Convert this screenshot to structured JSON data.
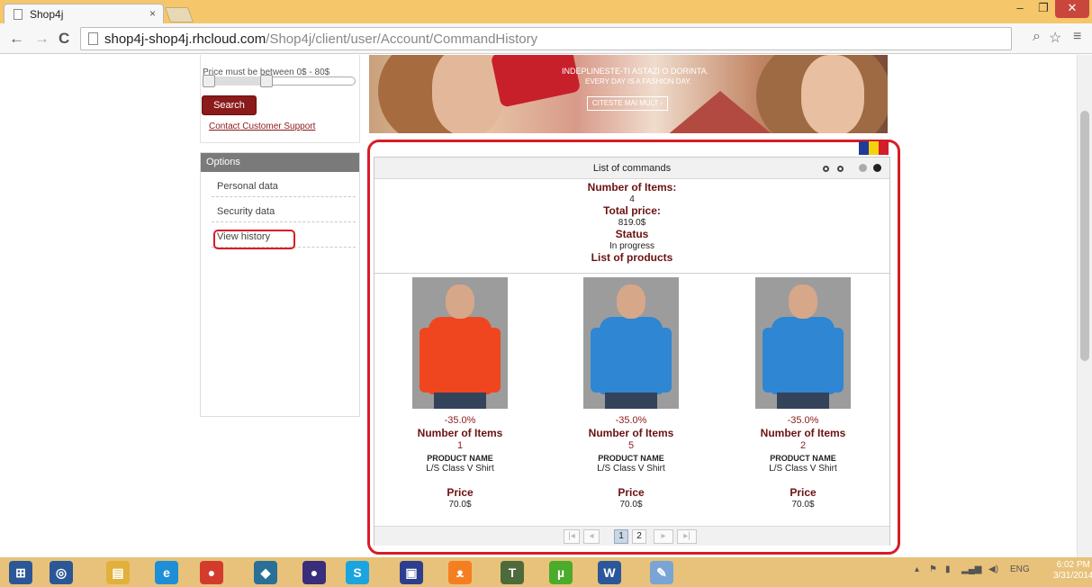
{
  "browser": {
    "tab_title": "Shop4j",
    "tab_close": "×",
    "url_host": "shop4j-shop4j.rhcloud.com",
    "url_path": "/Shop4j/client/user/Account/CommandHistory",
    "window_buttons": {
      "min": "–",
      "max": "❐",
      "close": "✕"
    },
    "nav": {
      "back": "←",
      "forward": "→",
      "reload": "C"
    },
    "tools": {
      "zoom": "⌕",
      "star": "☆",
      "menu": "≡"
    }
  },
  "sidebar": {
    "price_note": "Price must be between 0$ - 80$",
    "price_range": [
      0,
      40
    ],
    "search_label": "Search",
    "support_link": "Contact Customer Support",
    "options": {
      "header": "Options",
      "items": [
        {
          "label": "Personal data"
        },
        {
          "label": "Security data"
        },
        {
          "label": "View history"
        }
      ]
    }
  },
  "banner": {
    "line1": "INDEPLINESTE-TI ASTAZI O DORINTA.",
    "line2": "EVERY DAY IS A FASHION DAY.",
    "cta": "CITESTE MAI MULT ›"
  },
  "flag_colors": [
    "#1f3c99",
    "#f5d20c",
    "#d21e2b"
  ],
  "commands": {
    "title": "List of commands",
    "number_of_items_label": "Number of Items:",
    "number_of_items": "4",
    "total_price_label": "Total price:",
    "total_price": "819.0$",
    "status_label": "Status",
    "status": "In progress",
    "products_label": "List of products",
    "products": [
      {
        "discount": "-35.0%",
        "items_label": "Number of Items",
        "items": "1",
        "name_label": "PRODUCT NAME",
        "name": "L/S Class V Shirt",
        "price_label": "Price",
        "price": "70.0$",
        "shirt_color": "#f0461f",
        "side_color": "#555f6b"
      },
      {
        "discount": "-35.0%",
        "items_label": "Number of Items",
        "items": "5",
        "name_label": "PRODUCT NAME",
        "name": "L/S Class V Shirt",
        "price_label": "Price",
        "price": "70.0$",
        "shirt_color": "#2f86d3",
        "side_color": "#4d5866"
      },
      {
        "discount": "-35.0%",
        "items_label": "Number of Items",
        "items": "2",
        "name_label": "PRODUCT NAME",
        "name": "L/S Class V Shirt",
        "price_label": "Price",
        "price": "70.0$",
        "shirt_color": "#2f86d3",
        "side_color": "#4d5866"
      }
    ],
    "pager": {
      "first": "|◂",
      "prev": "◂",
      "pages": [
        "1",
        "2"
      ],
      "active": "1",
      "next": "▸",
      "last": "▸|"
    }
  },
  "taskbar": {
    "apps": [
      {
        "icon": "windows-start-icon",
        "glyph": "⊞",
        "color": "#2b5797"
      },
      {
        "icon": "circle-app-icon",
        "glyph": "◎",
        "color": "#2b5797"
      },
      {
        "icon": "file-explorer-icon",
        "glyph": "▤",
        "color": "#e2b13c"
      },
      {
        "icon": "internet-explorer-icon",
        "glyph": "e",
        "color": "#1e8fd6"
      },
      {
        "icon": "chrome-icon",
        "glyph": "●",
        "color": "#d33c2d"
      },
      {
        "icon": "mysql-workbench-icon",
        "glyph": "◆",
        "color": "#2a6f97"
      },
      {
        "icon": "eclipse-icon",
        "glyph": "●",
        "color": "#3a2d7c"
      },
      {
        "icon": "skype-icon",
        "glyph": "S",
        "color": "#1aa4e0"
      },
      {
        "icon": "save-app-icon",
        "glyph": "▣",
        "color": "#2d3e8f"
      },
      {
        "icon": "xampp-icon",
        "glyph": "ᴥ",
        "color": "#f57f20"
      },
      {
        "icon": "texmaker-icon",
        "glyph": "T",
        "color": "#4d6b3a"
      },
      {
        "icon": "utorrent-icon",
        "glyph": "µ",
        "color": "#4bab2a"
      },
      {
        "icon": "word-icon",
        "glyph": "W",
        "color": "#2b579a"
      },
      {
        "icon": "paint-icon",
        "glyph": "✎",
        "color": "#7aa4d6"
      }
    ],
    "tray": {
      "lang": "ENG",
      "time": "6:02 PM",
      "date": "3/31/2014"
    }
  }
}
